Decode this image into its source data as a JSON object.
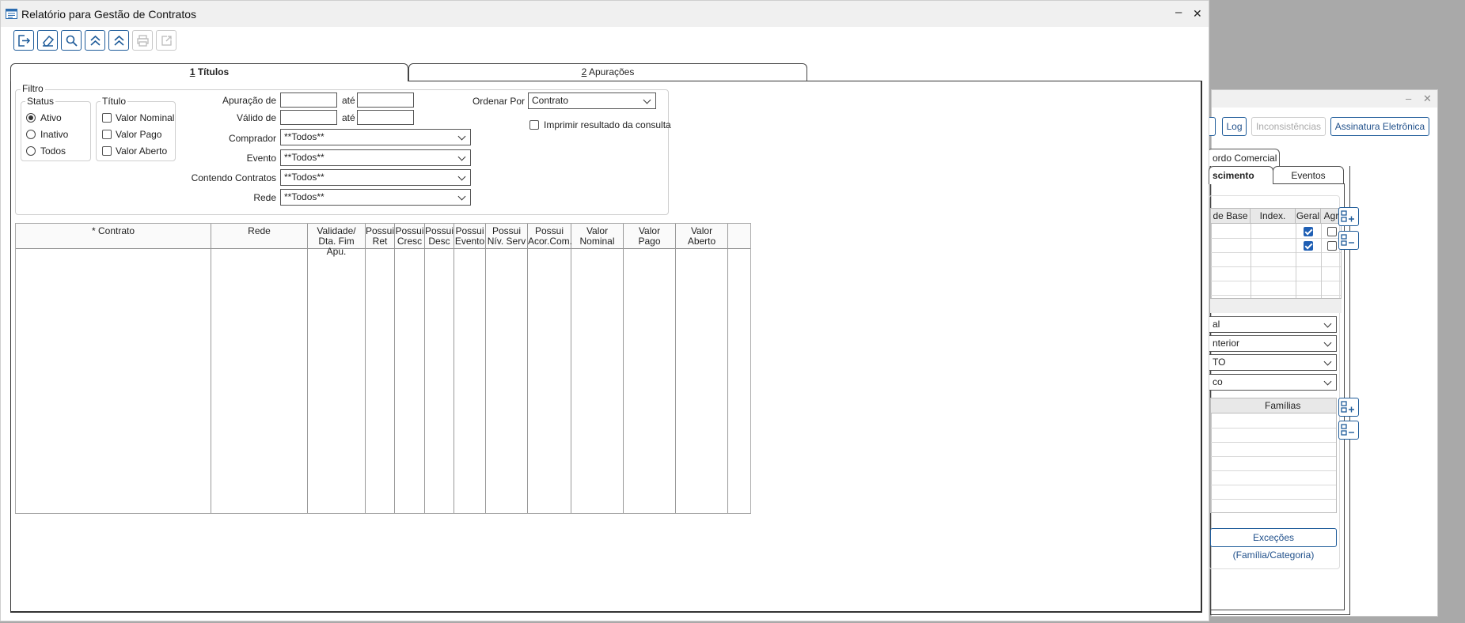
{
  "window": {
    "title": "Relatório para Gestão de Contratos"
  },
  "tabs": [
    {
      "num": "1",
      "label": " Títulos"
    },
    {
      "num": "2",
      "label": " Apurações"
    }
  ],
  "filter": {
    "group_label": "Filtro",
    "status": {
      "label": "Status",
      "options": [
        "Ativo",
        "Inativo",
        "Todos"
      ],
      "selected": "Ativo"
    },
    "titulo": {
      "label": "Título",
      "options": [
        "Valor Nominal",
        "Valor Pago",
        "Valor Aberto"
      ]
    },
    "apuracao_de": "Apuração de",
    "valido_de": "Válido de",
    "ate": "até",
    "comprador": {
      "label": "Comprador",
      "value": "**Todos**"
    },
    "evento": {
      "label": "Evento",
      "value": "**Todos**"
    },
    "contendo_contratos": {
      "label": "Contendo Contratos",
      "value": "**Todos**"
    },
    "rede": {
      "label": "Rede",
      "value": "**Todos**"
    },
    "ordenar_por": {
      "label": "Ordenar Por",
      "value": "Contrato"
    },
    "imprimir": "Imprimir resultado da consulta"
  },
  "grid": {
    "columns": [
      [
        "* Contrato",
        ""
      ],
      [
        "Rede",
        ""
      ],
      [
        "Validade/",
        "Dta. Fim Apu."
      ],
      [
        "Possui",
        "Ret"
      ],
      [
        "Possui",
        "Cresc"
      ],
      [
        "Possui",
        "Desc"
      ],
      [
        "Possui",
        "Evento"
      ],
      [
        "Possui",
        "Nív. Serv"
      ],
      [
        "Possui",
        "Acor.Com."
      ],
      [
        "Valor",
        "Nominal"
      ],
      [
        "Valor",
        "Pago"
      ],
      [
        "Valor",
        "Aberto"
      ],
      [
        "",
        ""
      ]
    ]
  },
  "background_window": {
    "buttons": {
      "log": "Log",
      "inconsistencias": "Inconsistências",
      "assinatura": "Assinatura Eletrônica"
    },
    "tabs": {
      "acordo": "ordo Comercial",
      "nascimento": "scimento",
      "eventos": "Eventos"
    },
    "grid1_headers": [
      "de Base",
      "Index.",
      "Geral",
      "Agr"
    ],
    "grid1_checks": [
      true,
      true
    ],
    "selects": [
      "al",
      "nterior",
      "TO",
      "co"
    ],
    "grid2_header": "Famílias",
    "excecoes": "Exceções (Família/Categoria)"
  },
  "icons": [
    "exit-icon",
    "eraser-icon",
    "search-icon",
    "collapse-up-icon",
    "expand-up-icon",
    "print-icon",
    "export-icon"
  ]
}
